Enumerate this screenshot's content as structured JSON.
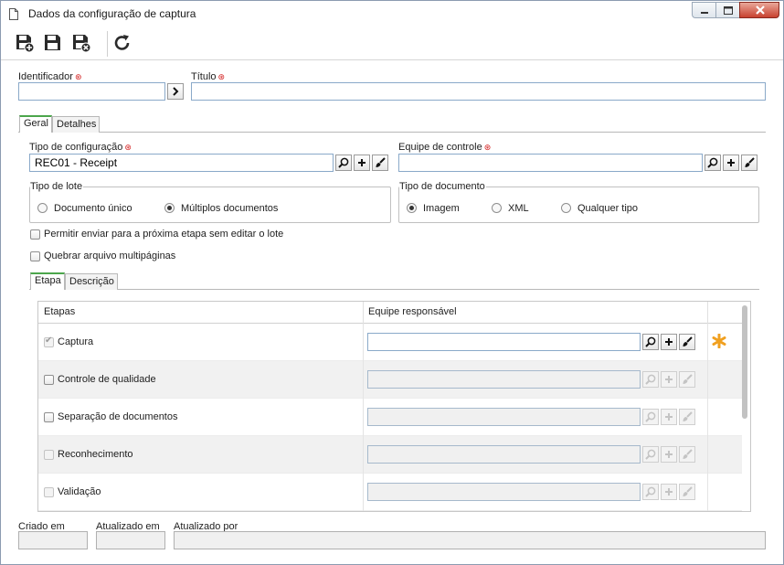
{
  "window": {
    "title": "Dados da configuração de captura"
  },
  "toolbar": {
    "buttons": [
      {
        "name": "save-new-button",
        "icon": "save-plus-icon"
      },
      {
        "name": "save-button",
        "icon": "save-icon"
      },
      {
        "name": "save-close-button",
        "icon": "save-close-icon"
      },
      {
        "name": "refresh-button",
        "icon": "refresh-icon"
      }
    ]
  },
  "header": {
    "identifier_label": "Identificador",
    "identifier_value": "",
    "title_label": "Título",
    "title_value": ""
  },
  "main_tabs": [
    {
      "label": "Geral",
      "active": true
    },
    {
      "label": "Detalhes",
      "active": false
    }
  ],
  "general": {
    "config_type_label": "Tipo de configuração",
    "config_type_value": "REC01 - Receipt",
    "control_team_label": "Equipe de controle",
    "control_team_value": "",
    "batch_type": {
      "legend": "Tipo de lote",
      "options": [
        "Documento único",
        "Múltiplos documentos"
      ],
      "selected": "Múltiplos documentos"
    },
    "doc_type": {
      "legend": "Tipo de documento",
      "options": [
        "Imagem",
        "XML",
        "Qualquer tipo"
      ],
      "selected": "Imagem"
    },
    "allow_next_label": "Permitir enviar para a próxima etapa sem editar o lote",
    "split_multipage_label": "Quebrar arquivo multipáginas"
  },
  "sub_tabs": [
    {
      "label": "Etapa",
      "active": true
    },
    {
      "label": "Descrição",
      "active": false
    }
  ],
  "steps_table": {
    "columns": [
      "Etapas",
      "Equipe responsável"
    ],
    "rows": [
      {
        "label": "Captura",
        "checked": true,
        "enabled_field": true,
        "required_marker": true
      },
      {
        "label": "Controle de qualidade",
        "checked": false,
        "enabled_field": false
      },
      {
        "label": "Separação de documentos",
        "checked": false,
        "enabled_field": false
      },
      {
        "label": "Reconhecimento",
        "checked": false,
        "enabled_field": false
      },
      {
        "label": "Validação",
        "checked": false,
        "enabled_field": false
      }
    ]
  },
  "footer": {
    "created_label": "Criado em",
    "updated_label": "Atualizado em",
    "updated_by_label": "Atualizado por"
  },
  "colors": {
    "required": "#d21a1a",
    "tab_accent": "#4ca64c",
    "field_border": "#8aa9c9",
    "required_star": "#f0a020"
  }
}
